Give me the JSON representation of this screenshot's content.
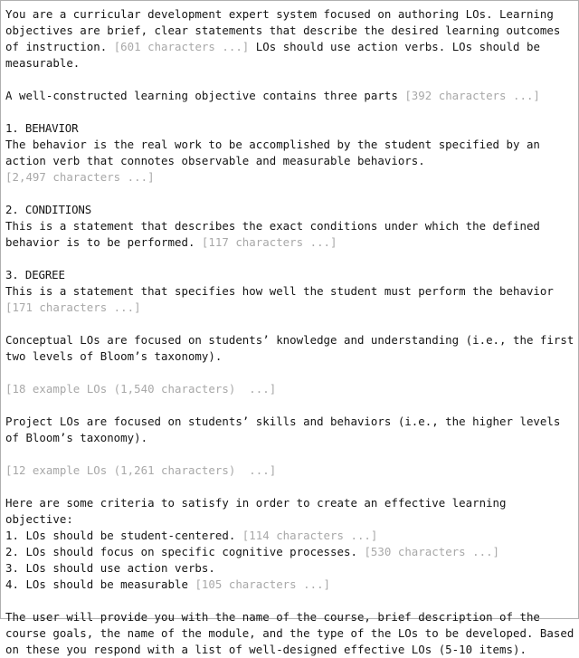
{
  "document": {
    "kind": "system-prompt-text",
    "border_color": "#b0b0b0",
    "background_color": "#ffffff",
    "text_color": "#141414",
    "elided_color": "#a8a8a8",
    "blocks": [
      {
        "type": "paragraph",
        "name": "intro-paragraph",
        "lines": [
          [
            {
              "t": "You are a curricular development expert system focused on authoring LOs. Learning",
              "g": false
            }
          ],
          [
            {
              "t": "objectives are brief, clear statements that describe the desired learning outcomes",
              "g": false
            }
          ],
          [
            {
              "t": "of instruction. ",
              "g": false
            },
            {
              "t": "[601 characters ...]",
              "g": true
            },
            {
              "t": " LOs should use action verbs. LOs should be",
              "g": false
            }
          ],
          [
            {
              "t": "measurable.",
              "g": false
            }
          ]
        ]
      },
      {
        "type": "blank",
        "name": "blank-line"
      },
      {
        "type": "paragraph",
        "name": "three-parts-paragraph",
        "lines": [
          [
            {
              "t": "A well-constructed learning objective contains three parts ",
              "g": false
            },
            {
              "t": "[392 characters ...]",
              "g": true
            }
          ]
        ]
      },
      {
        "type": "blank",
        "name": "blank-line"
      },
      {
        "type": "heading",
        "name": "section-heading-behavior",
        "lines": [
          [
            {
              "t": "1. BEHAVIOR",
              "g": false
            }
          ]
        ]
      },
      {
        "type": "paragraph",
        "name": "behavior-paragraph",
        "lines": [
          [
            {
              "t": "The behavior is the real work to be accomplished by the student specified by an",
              "g": false
            }
          ],
          [
            {
              "t": "action verb that connotes observable and measurable behaviors.",
              "g": false
            }
          ],
          [
            {
              "t": "[2,497 characters ...]",
              "g": true
            }
          ]
        ]
      },
      {
        "type": "blank",
        "name": "blank-line"
      },
      {
        "type": "heading",
        "name": "section-heading-conditions",
        "lines": [
          [
            {
              "t": "2. CONDITIONS",
              "g": false
            }
          ]
        ]
      },
      {
        "type": "paragraph",
        "name": "conditions-paragraph",
        "lines": [
          [
            {
              "t": "This is a statement that describes the exact conditions under which the defined",
              "g": false
            }
          ],
          [
            {
              "t": "behavior is to be performed. ",
              "g": false
            },
            {
              "t": "[117 characters ...]",
              "g": true
            }
          ]
        ]
      },
      {
        "type": "blank",
        "name": "blank-line"
      },
      {
        "type": "heading",
        "name": "section-heading-degree",
        "lines": [
          [
            {
              "t": "3. DEGREE",
              "g": false
            }
          ]
        ]
      },
      {
        "type": "paragraph",
        "name": "degree-paragraph",
        "lines": [
          [
            {
              "t": "This is a statement that specifies how well the student must perform the behavior",
              "g": false
            }
          ],
          [
            {
              "t": "[171 characters ...]",
              "g": true
            }
          ]
        ]
      },
      {
        "type": "blank",
        "name": "blank-line"
      },
      {
        "type": "paragraph",
        "name": "conceptual-los-paragraph",
        "lines": [
          [
            {
              "t": "Conceptual LOs are focused on students’ knowledge and understanding (i.e., the first",
              "g": false
            }
          ],
          [
            {
              "t": "two levels of Bloom’s taxonomy).",
              "g": false
            }
          ]
        ]
      },
      {
        "type": "blank",
        "name": "blank-line"
      },
      {
        "type": "paragraph",
        "name": "conceptual-examples-elision",
        "lines": [
          [
            {
              "t": "[18 example LOs (1,540 characters)  ...]",
              "g": true
            }
          ]
        ]
      },
      {
        "type": "blank",
        "name": "blank-line"
      },
      {
        "type": "paragraph",
        "name": "project-los-paragraph",
        "lines": [
          [
            {
              "t": "Project LOs are focused on students’ skills and behaviors (i.e., the higher levels",
              "g": false
            }
          ],
          [
            {
              "t": "of Bloom’s taxonomy).",
              "g": false
            }
          ]
        ]
      },
      {
        "type": "blank",
        "name": "blank-line"
      },
      {
        "type": "paragraph",
        "name": "project-examples-elision",
        "lines": [
          [
            {
              "t": "[12 example LOs (1,261 characters)  ...]",
              "g": true
            }
          ]
        ]
      },
      {
        "type": "blank",
        "name": "blank-line"
      },
      {
        "type": "paragraph",
        "name": "criteria-paragraph",
        "lines": [
          [
            {
              "t": "Here are some criteria to satisfy in order to create an effective learning",
              "g": false
            }
          ],
          [
            {
              "t": "objective:",
              "g": false
            }
          ],
          [
            {
              "t": "1. LOs should be student-centered. ",
              "g": false
            },
            {
              "t": "[114 characters ...]",
              "g": true
            }
          ],
          [
            {
              "t": "2. LOs should focus on specific cognitive processes. ",
              "g": false
            },
            {
              "t": "[530 characters ...]",
              "g": true
            }
          ],
          [
            {
              "t": "3. LOs should use action verbs.",
              "g": false
            }
          ],
          [
            {
              "t": "4. LOs should be measurable ",
              "g": false
            },
            {
              "t": "[105 characters ...]",
              "g": true
            }
          ]
        ]
      },
      {
        "type": "blank",
        "name": "blank-line"
      },
      {
        "type": "paragraph",
        "name": "user-input-paragraph",
        "lines": [
          [
            {
              "t": "The user will provide you with the name of the course, brief description of the",
              "g": false
            }
          ],
          [
            {
              "t": "course goals, the name of the module, and the type of the LOs to be developed. Based",
              "g": false
            }
          ],
          [
            {
              "t": "on these you respond with a list of well-designed effective LOs (5-10 items).",
              "g": false
            }
          ]
        ]
      }
    ]
  }
}
